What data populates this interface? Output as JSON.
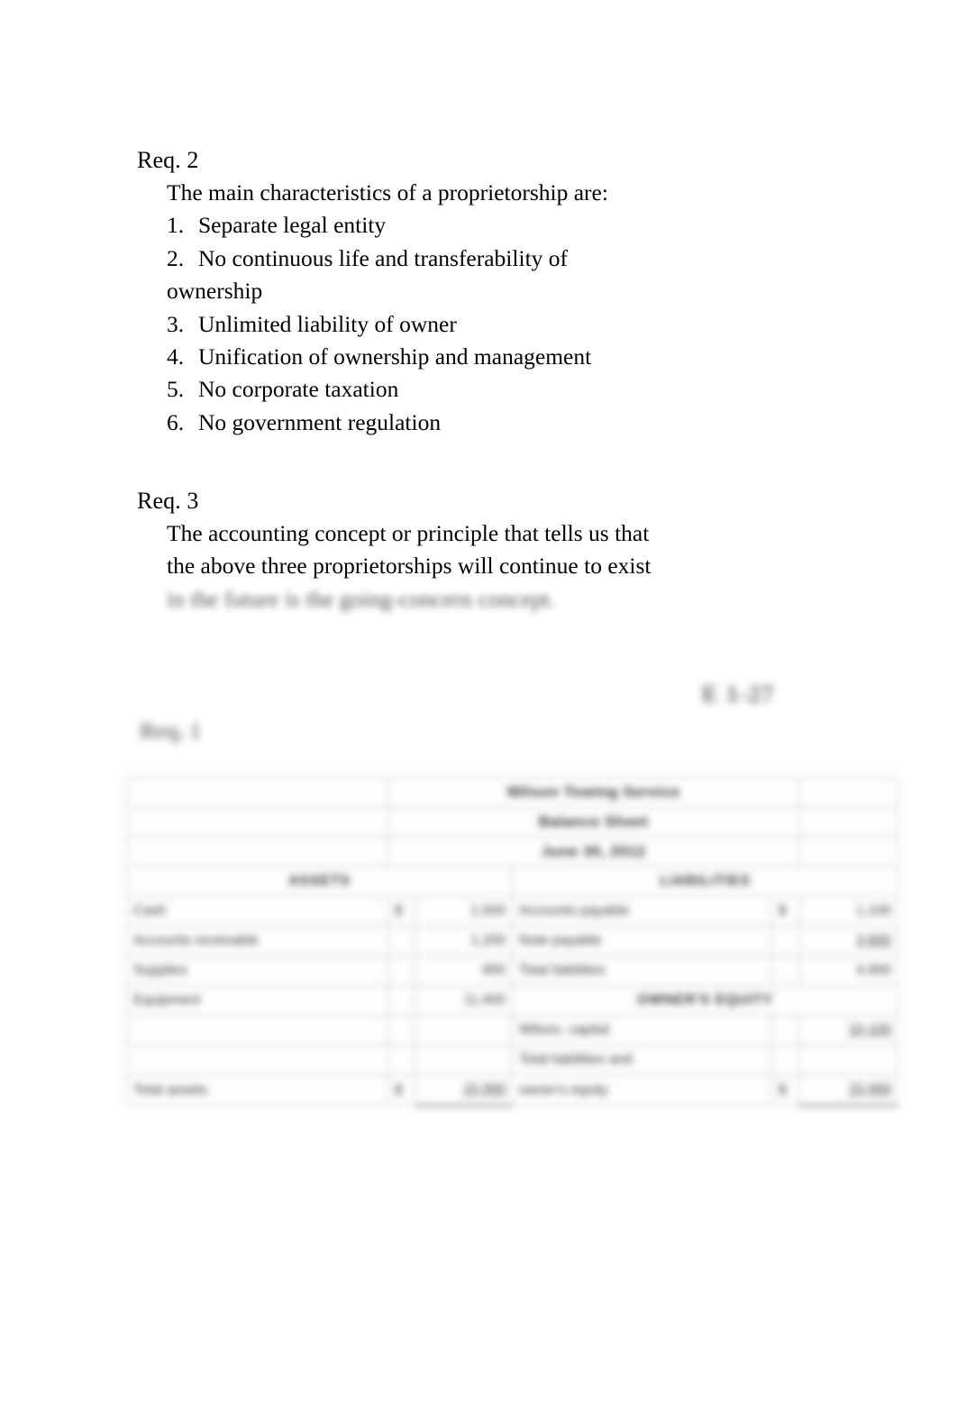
{
  "document": {
    "req2": {
      "heading": "Req. 2",
      "intro": "The main characteristics of a proprietorship are:",
      "items": [
        {
          "num": "1.",
          "text": "Separate legal entity"
        },
        {
          "num": "2.",
          "text": "No continuous life and transferability of"
        },
        {
          "num": "",
          "text": "ownership"
        },
        {
          "num": "3.",
          "text": "Unlimited liability of owner"
        },
        {
          "num": "4.",
          "text": "Unification of ownership and management"
        },
        {
          "num": "5.",
          "text": "No corporate taxation"
        },
        {
          "num": "6.",
          "text": "No government regulation"
        }
      ]
    },
    "req3": {
      "heading": "Req. 3",
      "line1": "The accounting concept or principle that tells us that",
      "line2": "the above three proprietorships will continue to exist",
      "line3": "in the future is the going-concern concept."
    },
    "exercise_tag": "E 1-27",
    "req1_label": "Req. 1"
  },
  "balance_sheet": {
    "company": "Wilson Towing Service",
    "statement": "Balance Sheet",
    "date": "June 30, 2012",
    "assets_header": "ASSETS",
    "liabilities_header": "LIABILITIES",
    "equity_header": "OWNER'S EQUITY",
    "assets": [
      {
        "label": "Cash",
        "currency": "$",
        "amount": "1,500"
      },
      {
        "label": "Accounts receivable",
        "currency": "",
        "amount": "1,200"
      },
      {
        "label": "Supplies",
        "currency": "",
        "amount": "900"
      },
      {
        "label": "Equipment",
        "currency": "",
        "amount": "11,400"
      }
    ],
    "assets_total": {
      "label": "Total assets",
      "currency": "$",
      "amount": "15,000"
    },
    "liabilities": [
      {
        "label": "Accounts payable",
        "currency": "$",
        "amount": "1,100"
      },
      {
        "label": "Note payable",
        "currency": "",
        "amount": "3,800"
      },
      {
        "label": "Total liabilities",
        "currency": "",
        "amount": "4,900"
      }
    ],
    "equity": [
      {
        "label": "Wilson, capital",
        "currency": "",
        "amount": "10,100"
      }
    ],
    "liab_equity_total": {
      "label_line1": "Total liabilities and",
      "label_line2": "owner's equity",
      "currency": "$",
      "amount": "15,000"
    }
  }
}
